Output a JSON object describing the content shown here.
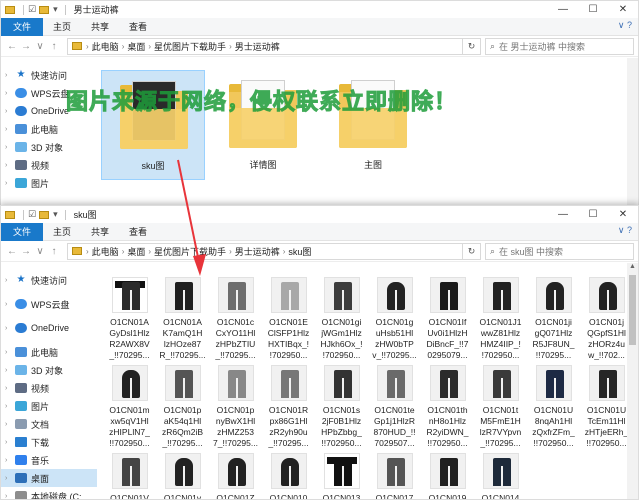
{
  "colors": {
    "accent": "#1979ca",
    "selection": "#cce4f7",
    "watermark": "#3ec85a",
    "arrow": "#e8343a",
    "folder": "#f1c75b"
  },
  "window1": {
    "title": "男士运动裤",
    "controls": {
      "minimize": "—",
      "maximize": "☐",
      "close": "✕"
    },
    "tabs": [
      "文件",
      "主页",
      "共享",
      "查看"
    ],
    "breadcrumb": [
      "此电脑",
      "桌面",
      "星优图片下载助手",
      "男士运动裤"
    ],
    "search_placeholder": "在 男士运动裤 中搜索",
    "items": [
      {
        "label": "sku图",
        "icon": "folder-icon"
      },
      {
        "label": "详情图",
        "icon": "folder-icon"
      },
      {
        "label": "主图",
        "icon": "folder-icon"
      }
    ],
    "watermark": "图片来源于网络，侵权联系立即删除！"
  },
  "window2": {
    "title": "sku图",
    "tabs": [
      "文件",
      "主页",
      "共享",
      "查看"
    ],
    "breadcrumb": [
      "此电脑",
      "桌面",
      "星优图片下载助手",
      "男士运动裤",
      "sku图"
    ],
    "search_placeholder": "在 sku图 中搜索",
    "files": [
      "O1CN01A\nGyDsl1Hlz\nR2AWX8V\n_!!70295...",
      "O1CN01A\nK7amQ1H\nlzHOze87\nR_!!70295...",
      "O1CN01c\nCxYO11Hl\nzHPbZTIU\n_!!70295...",
      "O1CN01E\nClSFP1Hlz\nHXTIBqx_!\n!702950...",
      "O1CN01gi\njWGm1Hlz\nHJkh6Ox_!\n!702950...",
      "O1CN01g\nuHsb51Hl\nzHW0bTP\nv_!!70295...",
      "O1CN01If\nUv0i1HlzH\nDiBncF_!!7\n0295079...",
      "O1CN01J1\nwwZ81Hlz\nHMZ4IIP_!\n!702950...",
      "O1CN01ji\ngQ071Hlz\nR5JF8UN_\n!!70295...",
      "O1CN01j\nQGpfS1Hl\nzHORz4u\nw_!!702...",
      "O1CN01m\nxw5qV1Hl\nzHIPLlN7_\n!!702950...",
      "O1CN01p\naK54q1Hl\nzR6Qm2iB\n_!!70295...",
      "O1CN01p\nnyBwX1Hl\nzHMZ253\n7_!!70295...",
      "O1CN01R\npx86G1Hl\nzR2yh90u\n_!!70295...",
      "O1CN01s\n2jF0B1Hlz\nHPbZbbg_\n!!702950...",
      "O1CN01te\nGp1j1HlzR\n870HUD_!!\n7029507...",
      "O1CN01th\nnH8o1Hlz\nR2yiDWN_\n!!702950...",
      "O1CN01t\nM5FmE1H\nlzR7VYpvn\n_!!70295...",
      "O1CN01U\n8nqAh1Hl\nzQxfrZFm_\n!!702950...",
      "O1CN01U\nTcEm11Hl\nzHTjeERh_\n!!702950...",
      "O1CN01V",
      "O1CN01v",
      "O1CN01Z",
      "O1CN010",
      "O1CN013",
      "O1CN017",
      "O1CN019",
      "O1CN014"
    ]
  },
  "nav": [
    {
      "label": "快速访问",
      "icon": "star-icon"
    },
    {
      "label": "WPS云盘",
      "icon": "cloud-icon"
    },
    {
      "label": "OneDrive",
      "icon": "onedrive-icon"
    },
    {
      "label": "此电脑",
      "icon": "pc-icon"
    },
    {
      "label": "3D 对象",
      "icon": "3d-objects-icon"
    },
    {
      "label": "视频",
      "icon": "video-icon"
    },
    {
      "label": "图片",
      "icon": "pictures-icon"
    },
    {
      "label": "文档",
      "icon": "documents-icon"
    },
    {
      "label": "下载",
      "icon": "download-icon"
    },
    {
      "label": "音乐",
      "icon": "music-icon"
    },
    {
      "label": "桌面",
      "icon": "desktop-icon"
    },
    {
      "label": "本地磁盘 (C:",
      "icon": "disk-icon"
    }
  ],
  "glyphs": {
    "back": "←",
    "forward": "→",
    "up": "↑",
    "down": "∨",
    "chevron": "›",
    "refresh": "↻",
    "search": "⌕",
    "expand": "›",
    "help": "∨ ?"
  }
}
